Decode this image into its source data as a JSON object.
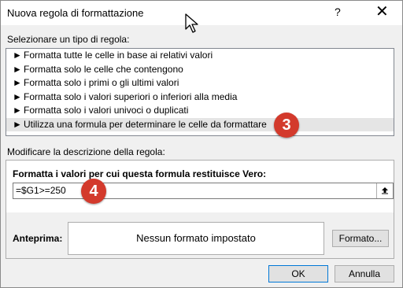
{
  "window": {
    "title": "Nuova regola di formattazione",
    "help": "?",
    "close": "✕"
  },
  "rule_type": {
    "label": "Selezionare un tipo di regola:",
    "items": [
      {
        "label": "Formatta tutte le celle in base ai relativi valori"
      },
      {
        "label": "Formatta solo le celle che contengono"
      },
      {
        "label": "Formatta solo i primi o gli ultimi valori"
      },
      {
        "label": "Formatta solo i valori superiori o inferiori alla media"
      },
      {
        "label": "Formatta solo i valori univoci o duplicati"
      },
      {
        "label": "Utilizza una formula per determinare le celle da formattare",
        "selected": true
      }
    ],
    "bullet": "►"
  },
  "step_badges": [
    "3",
    "4"
  ],
  "description": {
    "label": "Modificare la descrizione della regola:",
    "formula_label": "Formatta i valori per cui questa formula restituisce Vero:",
    "formula_value": "=$G1>=250",
    "preview_label": "Anteprima:",
    "preview_text": "Nessun formato impostato",
    "format_button": "Formato..."
  },
  "buttons": {
    "ok": "OK",
    "cancel": "Annulla"
  },
  "colors": {
    "badge": "#d33a2c",
    "selected_row": "#e5e5e5",
    "ok_border": "#0078d7"
  },
  "icons": {
    "cursor": "mouse-pointer-icon",
    "collapse": "collapse-dialog-icon"
  }
}
